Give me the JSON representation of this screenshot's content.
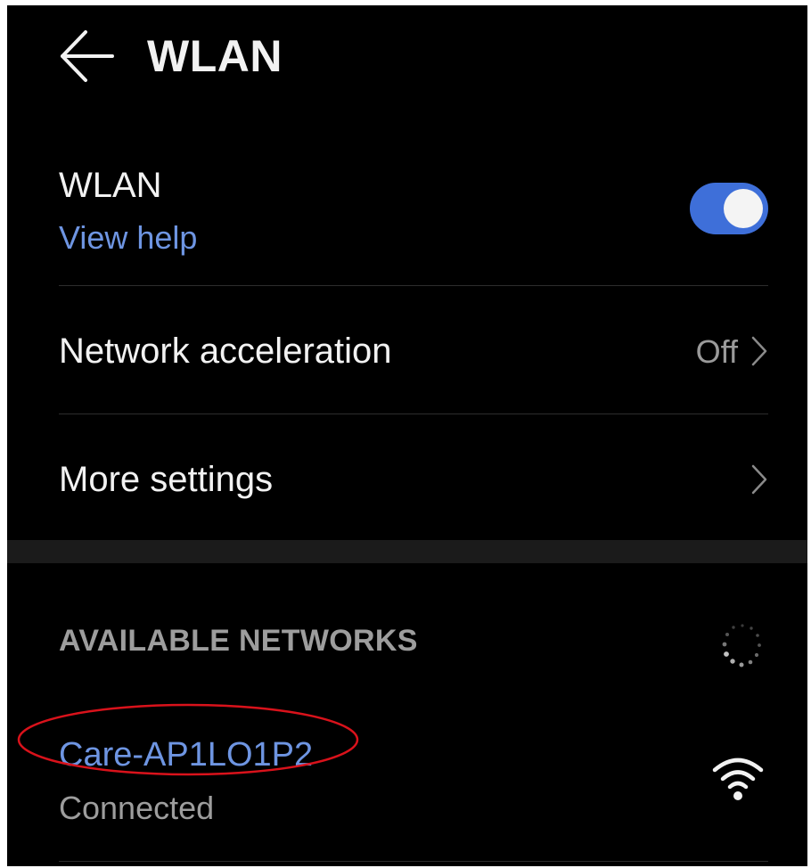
{
  "header": {
    "title": "WLAN",
    "back_icon": "back-arrow-icon"
  },
  "wlan": {
    "title": "WLAN",
    "help_link": "View help",
    "enabled": true,
    "toggle_color": "#3e6fd9"
  },
  "network_acceleration": {
    "label": "Network acceleration",
    "value": "Off",
    "icon": "chevron-right-icon"
  },
  "more_settings": {
    "label": "More settings",
    "icon": "chevron-right-icon"
  },
  "available_networks": {
    "header": "AVAILABLE NETWORKS",
    "scanning_icon": "loading-spinner-icon",
    "networks": [
      {
        "ssid": "Care-AP1LO1P2",
        "status": "Connected",
        "signal_icon": "wifi-signal-icon",
        "highlighted": true
      }
    ]
  },
  "colors": {
    "background": "#000000",
    "accent": "#6e95e2",
    "annotation": "#d9121b"
  }
}
